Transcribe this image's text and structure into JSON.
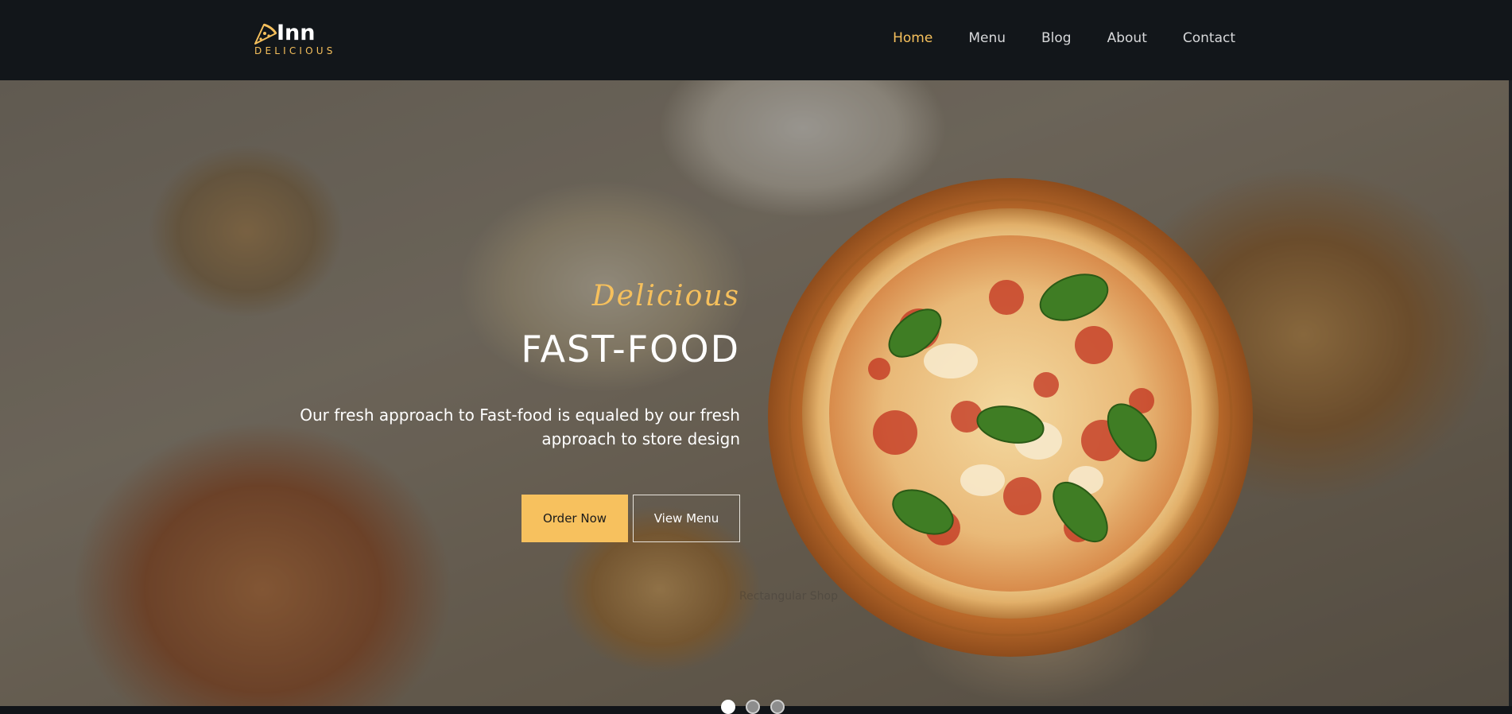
{
  "brand": {
    "name": "Inn",
    "subtitle": "DELICIOUS",
    "accent_color": "#f6c05c"
  },
  "nav": {
    "items": [
      {
        "label": "Home",
        "active": true
      },
      {
        "label": "Menu",
        "active": false
      },
      {
        "label": "Blog",
        "active": false
      },
      {
        "label": "About",
        "active": false
      },
      {
        "label": "Contact",
        "active": false
      }
    ]
  },
  "hero": {
    "tagline": "Delicious",
    "headline": "FAST-FOOD",
    "description": "Our fresh approach to Fast-food is equaled by our fresh approach to store design",
    "order_button": "Order Now",
    "view_button": "View Menu",
    "ghost_label": "Rectangular Shop",
    "slider_dots": 3,
    "active_slide": 1
  },
  "icons": {
    "logo": "pizza-slice-icon"
  }
}
